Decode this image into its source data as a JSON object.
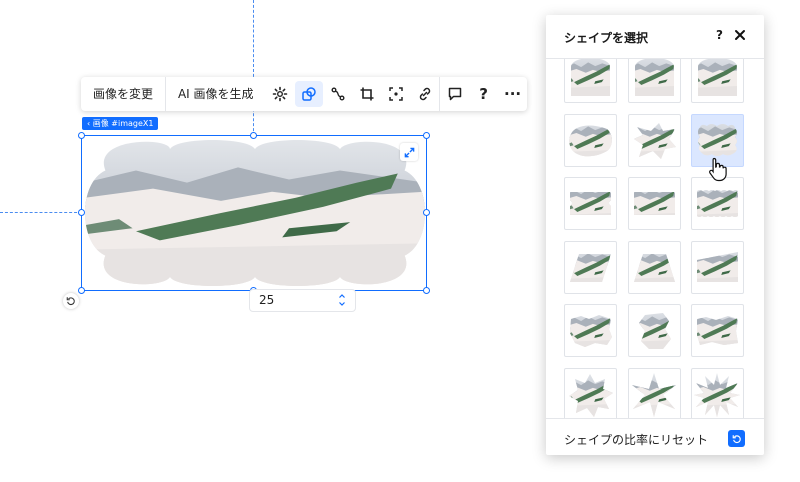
{
  "toolbar": {
    "change_image": "画像を変更",
    "ai_generate": "AI 画像を生成",
    "help": "?",
    "more": "···"
  },
  "element_tag": "‹ 画像 #imageX1",
  "stepper": {
    "value": "25"
  },
  "panel": {
    "title": "シェイプを選択",
    "help": "?",
    "reset_label": "シェイプの比率にリセット"
  },
  "shapes": [
    {
      "name": "shape-arch-bottom",
      "selected": false
    },
    {
      "name": "shape-arch-bottom-2",
      "selected": false
    },
    {
      "name": "shape-arch-bottom-3",
      "selected": false
    },
    {
      "name": "shape-cloud",
      "selected": false
    },
    {
      "name": "shape-splash",
      "selected": false
    },
    {
      "name": "shape-scalloped",
      "selected": true
    },
    {
      "name": "shape-ticket",
      "selected": false
    },
    {
      "name": "shape-notched",
      "selected": false
    },
    {
      "name": "shape-stamp",
      "selected": false
    },
    {
      "name": "shape-parallelogram",
      "selected": false
    },
    {
      "name": "shape-trapezoid",
      "selected": false
    },
    {
      "name": "shape-slant",
      "selected": false
    },
    {
      "name": "shape-torn",
      "selected": false
    },
    {
      "name": "shape-blob-vertical",
      "selected": false
    },
    {
      "name": "shape-torn-rect",
      "selected": false
    },
    {
      "name": "shape-burst",
      "selected": false
    },
    {
      "name": "shape-star",
      "selected": false
    },
    {
      "name": "shape-flower",
      "selected": false
    }
  ],
  "colors": {
    "accent": "#116dff",
    "selected_bg": "#dbe7ff"
  }
}
